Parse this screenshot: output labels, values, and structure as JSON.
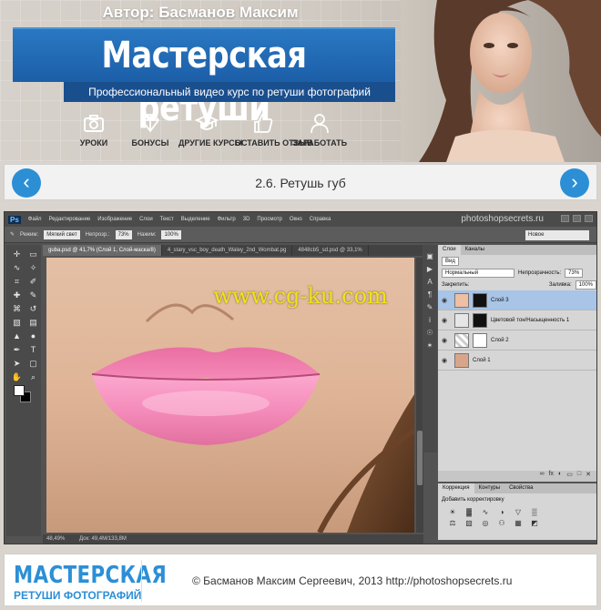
{
  "header": {
    "author": "Автор: Басманов Максим",
    "title": "Мастерская ретуши",
    "subtitle": "Профессиональный видео курс по ретуши фотографий",
    "nav": [
      {
        "label": "УРОКИ",
        "icon": "camera-icon"
      },
      {
        "label": "БОНУСЫ",
        "icon": "diamond-icon"
      },
      {
        "label": "ДРУГИЕ КУРСЫ",
        "icon": "graduation-cap-icon"
      },
      {
        "label": "ОСТАВИТЬ ОТЗЫВ",
        "icon": "thumbs-up-icon"
      },
      {
        "label": "ЗАРАБОТАТЬ",
        "icon": "user-icon"
      }
    ]
  },
  "lesson": {
    "title": "2.6. Ретушь губ",
    "prev_icon": "chevron-left-icon",
    "next_icon": "chevron-right-icon"
  },
  "photoshop": {
    "logo": "Ps",
    "menu": [
      "Файл",
      "Редактирование",
      "Изображение",
      "Слои",
      "Текст",
      "Выделение",
      "Фильтр",
      "3D",
      "Просмотр",
      "Окно",
      "Справка"
    ],
    "watermark": "photoshopsecrets.ru",
    "options": {
      "mode_label": "Режим:",
      "mode": "Мягкий свет",
      "opacity_label": "Непрозр.:",
      "opacity": "73%",
      "flow_label": "Нажим:",
      "flow": "100%"
    },
    "workspace": "Новое",
    "tabs": [
      "guba.psd @ 41,7% (Слой 1, Слой-маска/8)",
      "4_stary_vsc_boy_death_Waley_2nd_Wombat.pg",
      "4848cb5_sd.psd @ 33,1%"
    ],
    "overlay_watermark": "www.cg-ku.com",
    "status": {
      "zoom": "48,49%",
      "doc": "Док: 49,4M/133,8M"
    },
    "layers_panel": {
      "tabs": [
        "Слои",
        "Каналы"
      ],
      "kind": "Вид",
      "blend_mode": "Нормальный",
      "opacity_label": "Непрозрачность:",
      "opacity": "73%",
      "lock_label": "Закрепить:",
      "fill_label": "Заливка:",
      "fill": "100%",
      "layers": [
        {
          "name": "Слой 3",
          "selected": true
        },
        {
          "name": "Цветовой тон/Насыщенность 1",
          "selected": false
        },
        {
          "name": "Слой 2",
          "selected": false
        },
        {
          "name": "Слой 1",
          "selected": false
        }
      ]
    },
    "adjustments_panel": {
      "tabs": [
        "Коррекция",
        "Контуры",
        "Свойства"
      ],
      "title": "Добавить корректировку"
    }
  },
  "footer": {
    "logo_line1": "МАСТЕРСКАЯ",
    "logo_line2": "РЕТУШИ ФОТОГРАФИЙ",
    "copyright": "© Басманов Максим Сергеевич, 2013 http://photoshopsecrets.ru"
  },
  "colors": {
    "accent": "#2c8fd6",
    "title_band": "#1c5ea8",
    "ps_dark": "#535353",
    "overlay": "#f2e31a"
  }
}
